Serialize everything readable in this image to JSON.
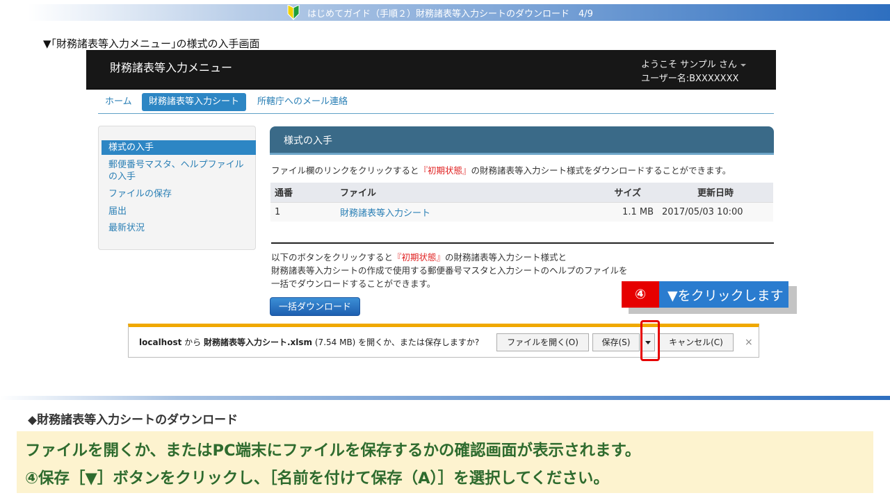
{
  "slide": {
    "title": "はじめてガイド（手順２）財務諸表等入力シートのダウンロード　4/9",
    "section_caption": "▼｢財務諸表等入力メニュー｣の様式の入手画面"
  },
  "app": {
    "title": "財務諸表等入力メニュー",
    "user_welcome": "ようこそ サンプル さん",
    "user_id": "ユーザー名:BXXXXXXX",
    "nav": {
      "home": "ホーム",
      "input_sheet": "財務諸表等入力シート",
      "mail": "所轄庁へのメール連絡"
    },
    "sidebar": [
      "様式の入手",
      "郵便番号マスタ、ヘルプファイルの入手",
      "ファイルの保存",
      "届出",
      "最新状況"
    ],
    "panel": {
      "title": "様式の入手",
      "desc_prefix": "ファイル欄のリンクをクリックすると",
      "desc_highlight": "『初期状態』",
      "desc_suffix": "の財務諸表等入力シート様式をダウンロードすることができます。",
      "table": {
        "headers": {
          "no": "通番",
          "file": "ファイル",
          "size": "サイズ",
          "date": "更新日時"
        },
        "rows": [
          {
            "no": "1",
            "file": "財務諸表等入力シート",
            "size": "1.1 MB",
            "date": "2017/05/03 10:00"
          }
        ]
      },
      "bulk_line1_prefix": "以下のボタンをクリックすると",
      "bulk_line1_highlight": "『初期状態』",
      "bulk_line1_suffix": "の財務諸表等入力シート様式と",
      "bulk_line2": "財務諸表等入力シートの作成で使用する郵便番号マスタと入力シートのヘルプのファイルを",
      "bulk_line3": "一括でダウンロードすることができます。",
      "bulk_button": "一括ダウンロード"
    }
  },
  "callout": {
    "number": "④",
    "text": "▼をクリックします"
  },
  "download_bar": {
    "host": "localhost",
    "from": " から ",
    "filename": "財務諸表等入力シート.xlsm",
    "size_text": " (7.54 MB) を開くか、または保存しますか?",
    "open_button": "ファイルを開く(O)",
    "save_button": "保存(S)",
    "cancel_button": "キャンセル(C)",
    "close": "×"
  },
  "bottom": {
    "heading": "◆財務諸表等入力シートのダウンロード",
    "line1": "ファイルを開くか、またはPC端末にファイルを保存するかの確認画面が表示されます。",
    "line2": "④保存［▼］ボタンをクリックし、［名前を付けて保存（A）］を選択してください。"
  },
  "colors": {
    "accent": "#2d86c4",
    "header": "#171717",
    "panel": "#3a6a88",
    "highlight": "#e60000",
    "note_bg": "#fdf3cf",
    "note_text": "#2e6b2e"
  },
  "icons": {
    "beginner": "wakaba-icon",
    "dropdown": "caret-down-icon"
  }
}
